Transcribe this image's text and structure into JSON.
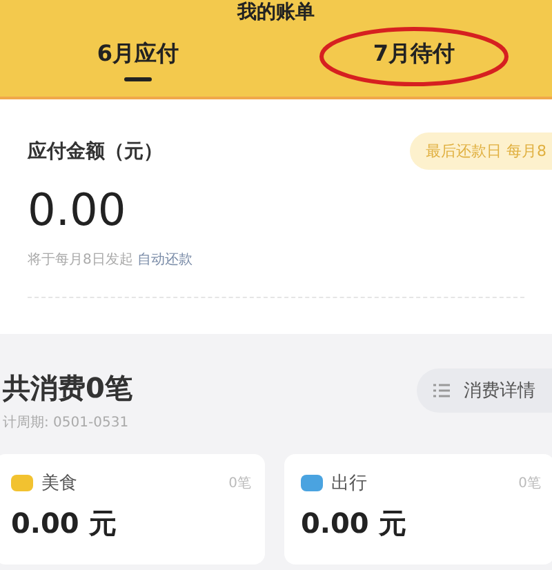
{
  "header": {
    "title": "我的账单"
  },
  "tabs": [
    {
      "label": "6月应付",
      "selected": true
    },
    {
      "label": "7月待付",
      "selected": false,
      "circled": true
    }
  ],
  "bill": {
    "label": "应付金额（元）",
    "due_badge": "最后还款日 每月8",
    "amount": "0.00",
    "note": "将于每月8日发起",
    "note_link": "自动还款"
  },
  "summary": {
    "title": "共消费0笔",
    "period": "计周期: 0501-0531",
    "details_button": "消费详情"
  },
  "categories": [
    {
      "name": "美食",
      "count": "0笔",
      "amount": "0.00 元",
      "color": "#f2c230"
    },
    {
      "name": "出行",
      "count": "0笔",
      "amount": "0.00 元",
      "color": "#4aa3e0"
    }
  ]
}
